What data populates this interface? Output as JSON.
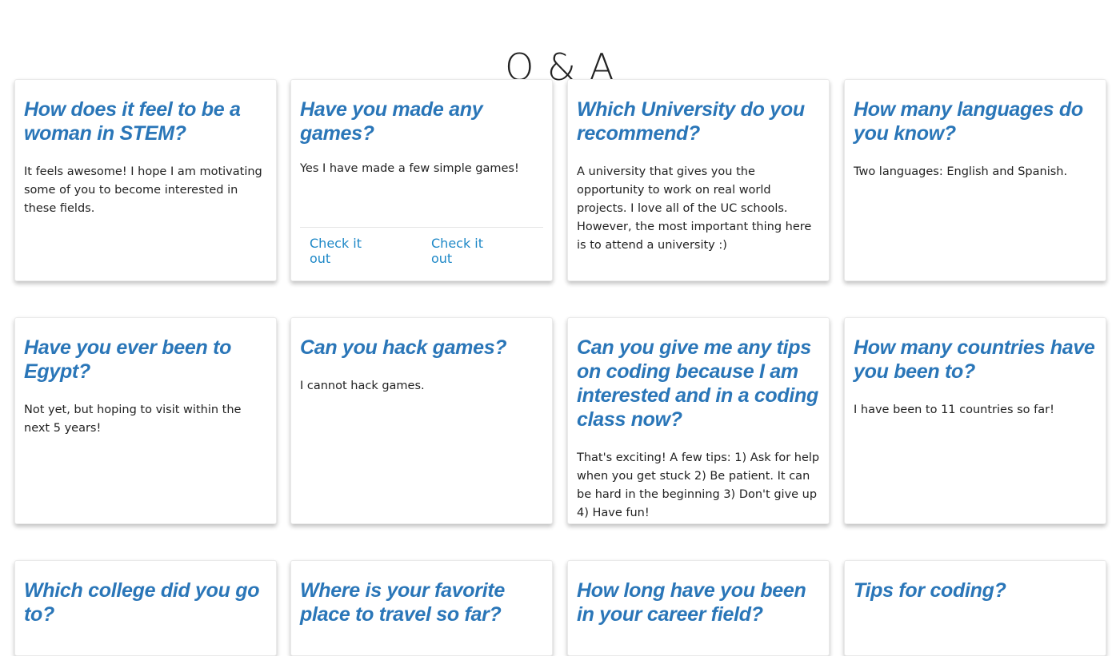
{
  "page": {
    "title": "Q & A"
  },
  "cards": [
    {
      "question": "How does it feel to be a woman in STEM?",
      "answer": "It feels awesome! I hope I am motivating some of you to become interested in these fields."
    },
    {
      "question": "Have you made any games?",
      "answer": "Yes I have made a few simple games!",
      "links": [
        "Check it out",
        "Check it out"
      ]
    },
    {
      "question": "Which University do you recommend?",
      "answer": "A university that gives you the opportunity to work on real world projects. I love all of the UC schools. However, the most important thing here is to attend a university :)"
    },
    {
      "question": "How many languages do you know?",
      "answer": "Two languages: English and Spanish."
    },
    {
      "question": "Have you ever been to Egypt?",
      "answer": "Not yet, but hoping to visit within the next 5 years!"
    },
    {
      "question": "Can you hack games?",
      "answer": "I cannot hack games."
    },
    {
      "question": "Can you give me any tips on coding because I am interested and in a coding class now?",
      "answer": "That's exciting! A few tips: 1) Ask for help when you get stuck 2) Be patient. It can be hard in the beginning 3) Don't give up 4) Have fun!"
    },
    {
      "question": "How many countries have you been to?",
      "answer": "I have been to 11 countries so far!"
    },
    {
      "question": "Which college did you go to?",
      "answer": ""
    },
    {
      "question": "Where is your favorite place to travel so far?",
      "answer": ""
    },
    {
      "question": "How long have you been in your career field?",
      "answer": ""
    },
    {
      "question": "Tips for coding?",
      "answer": ""
    }
  ]
}
